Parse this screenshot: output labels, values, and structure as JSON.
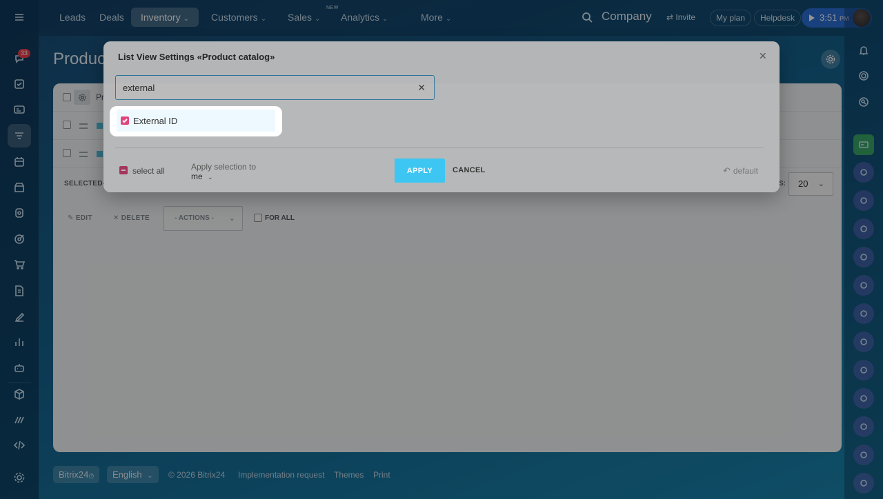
{
  "topbar": {
    "nav": [
      {
        "label": "Leads",
        "chevron": false
      },
      {
        "label": "Deals",
        "chevron": false
      },
      {
        "label": "Inventory",
        "chevron": true
      },
      {
        "label": "Customers",
        "chevron": true
      },
      {
        "label": "Sales",
        "chevron": true
      },
      {
        "label": "Analytics",
        "chevron": true
      },
      {
        "label": "More",
        "chevron": true
      }
    ],
    "sales_badge": "NEW",
    "company": "Company",
    "invite": "Invite",
    "my_plan": "My plan",
    "helpdesk": "Helpdesk",
    "time": "3:51",
    "time_suffix": "PM"
  },
  "sidebar": {
    "notification_count": "33",
    "icons": [
      "menu-icon",
      "feed-icon",
      "tasks-icon",
      "crm-icon",
      "inventory-icon",
      "calendar-icon",
      "store-icon",
      "contact-center-icon",
      "target-icon",
      "cart-icon",
      "document-icon",
      "sign-icon",
      "analytics-icon",
      "robot-icon",
      "box-icon",
      "automation-icon",
      "code-icon",
      "settings-icon"
    ]
  },
  "page": {
    "title": "Product catalog",
    "title_visible": "Produc",
    "column_first": "Pr",
    "selected_label": "SELECTED:",
    "selected_visible": "SELECTED-",
    "page_size_label": "RECORDS:",
    "page_size_visible": "S:",
    "page_size": "20",
    "edit": "EDIT",
    "delete": "DELETE",
    "actions": "- ACTIONS -",
    "for_all": "FOR ALL"
  },
  "footer": {
    "brand": "Bitrix24",
    "language": "English",
    "copyright": "© 2026 Bitrix24",
    "links": [
      "Implementation request",
      "Themes",
      "Print"
    ]
  },
  "modal": {
    "title": "List View Settings «Product catalog»",
    "search_value": "external",
    "field_item": {
      "label": "External ID",
      "checked": true
    },
    "select_all": "select all",
    "apply_selection_to": "Apply selection to",
    "apply_selection_value": "me",
    "apply": "APPLY",
    "cancel": "CANCEL",
    "default": "default"
  },
  "colors": {
    "accent": "#3bc8f5",
    "checkbox": "#e0467c",
    "search_border": "#3ea4d3"
  }
}
